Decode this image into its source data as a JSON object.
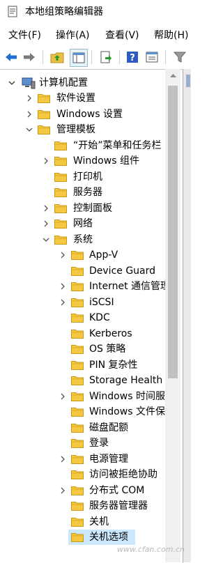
{
  "window": {
    "title": "本地组策略编辑器"
  },
  "menu": [
    "文件(F)",
    "操作(A)",
    "查看(V)",
    "帮助(H)"
  ],
  "toolbar": {
    "buttons": [
      "back-icon",
      "forward-icon",
      "up-folder-icon",
      "show-hide-tree-icon",
      "export-list-icon",
      "help-icon",
      "properties-icon",
      "filter-icon"
    ]
  },
  "tree": {
    "root": "计算机配置",
    "items": [
      {
        "label": "软件设置",
        "expander": "collapsed"
      },
      {
        "label": "Windows 设置",
        "expander": "collapsed"
      },
      {
        "label": "管理模板",
        "expander": "expanded"
      },
      {
        "label": "“开始”菜单和任务栏",
        "expander": "none"
      },
      {
        "label": "Windows 组件",
        "expander": "collapsed"
      },
      {
        "label": "打印机",
        "expander": "none"
      },
      {
        "label": "服务器",
        "expander": "none"
      },
      {
        "label": "控制面板",
        "expander": "collapsed"
      },
      {
        "label": "网络",
        "expander": "collapsed"
      },
      {
        "label": "系统",
        "expander": "expanded"
      },
      {
        "label": "App-V",
        "expander": "collapsed"
      },
      {
        "label": "Device Guard",
        "expander": "none"
      },
      {
        "label": "Internet 通信管理",
        "expander": "collapsed"
      },
      {
        "label": "iSCSI",
        "expander": "collapsed"
      },
      {
        "label": "KDC",
        "expander": "none"
      },
      {
        "label": "Kerberos",
        "expander": "none"
      },
      {
        "label": "OS 策略",
        "expander": "none"
      },
      {
        "label": "PIN 复杂性",
        "expander": "none"
      },
      {
        "label": "Storage Health",
        "expander": "none"
      },
      {
        "label": "Windows 时间服务",
        "expander": "collapsed"
      },
      {
        "label": "Windows 文件保护",
        "expander": "none"
      },
      {
        "label": "磁盘配额",
        "expander": "none"
      },
      {
        "label": "登录",
        "expander": "none"
      },
      {
        "label": "电源管理",
        "expander": "collapsed"
      },
      {
        "label": "访问被拒绝协助",
        "expander": "none"
      },
      {
        "label": "分布式 COM",
        "expander": "collapsed"
      },
      {
        "label": "服务器管理器",
        "expander": "none"
      },
      {
        "label": "关机",
        "expander": "none"
      },
      {
        "label": "关机选项",
        "expander": "none",
        "selected": true
      }
    ]
  },
  "watermark": "www.cfan.com.cn",
  "colors": {
    "folder": "#f5c842",
    "selection": "#cce8ff",
    "accent": "#1e6fd0"
  }
}
